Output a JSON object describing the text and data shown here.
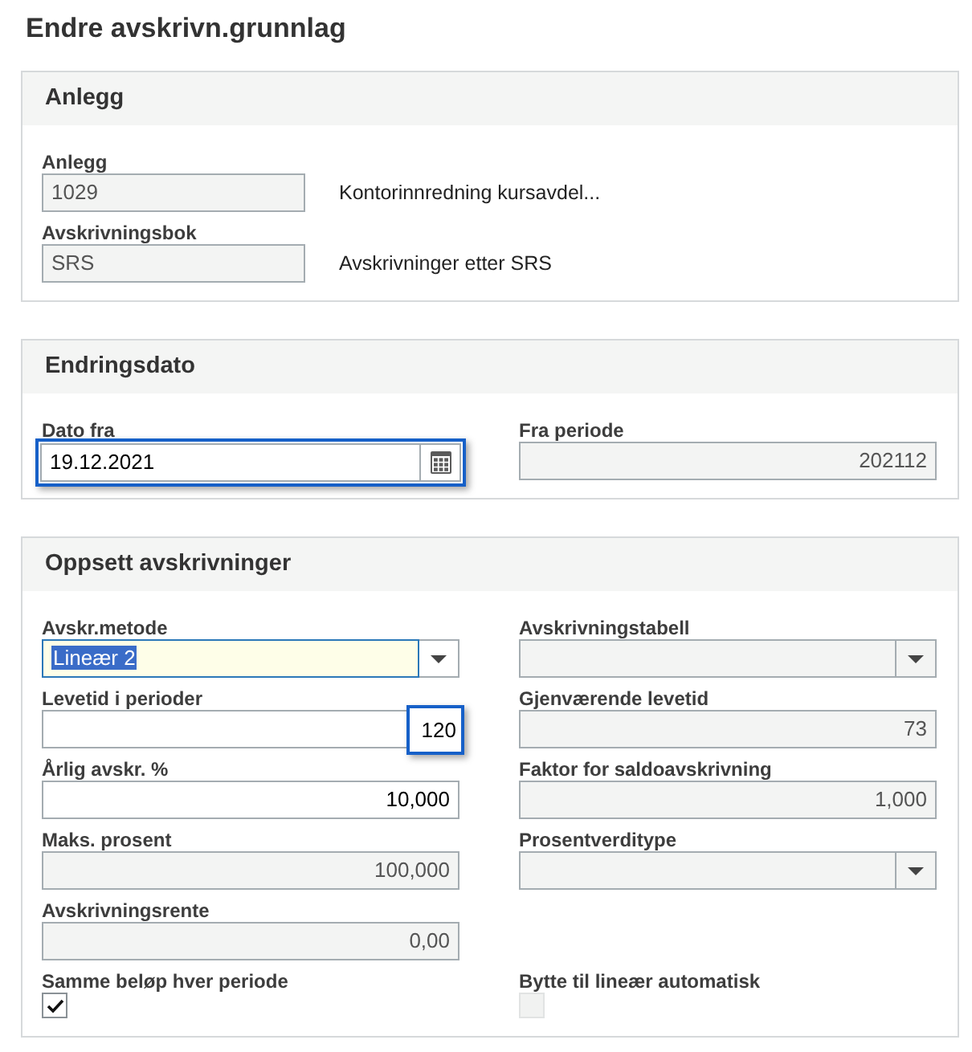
{
  "title": "Endre avskrivn.grunnlag",
  "sections": [
    {
      "heading": "Anlegg",
      "rows": [
        [
          {
            "kind": "text",
            "label": "Anlegg",
            "value": "1029",
            "disabled": true,
            "highlighted": false,
            "description": "Kontorinnredning kursavdel..."
          }
        ],
        [
          {
            "kind": "text",
            "label": "Avskrivningsbok",
            "value": "SRS",
            "disabled": true,
            "highlighted": false,
            "description": "Avskrivninger etter SRS"
          }
        ]
      ]
    },
    {
      "heading": "Endringsdato",
      "rows": [
        [
          {
            "kind": "date",
            "label": "Dato fra",
            "value": "19.12.2021",
            "disabled": false,
            "highlighted": true
          },
          {
            "kind": "number",
            "label": "Fra periode",
            "value": "202112",
            "disabled": true,
            "highlighted": false
          }
        ]
      ]
    },
    {
      "heading": "Oppsett avskrivninger",
      "rows": [
        [
          {
            "kind": "select",
            "label": "Avskr.metode",
            "value": "Lineær 2",
            "disabled": false,
            "highlighted": false,
            "active": true,
            "text_selected": true
          },
          {
            "kind": "select",
            "label": "Avskrivningstabell",
            "disabled": true,
            "highlighted": false,
            "active": false
          }
        ],
        [
          {
            "kind": "number",
            "label": "Levetid i perioder",
            "value": "120",
            "disabled": false,
            "highlighted": true
          },
          {
            "kind": "number",
            "label": "Gjenværende levetid",
            "value": "73",
            "disabled": true,
            "highlighted": false
          }
        ],
        [
          {
            "kind": "number",
            "label": "Årlig avskr. %",
            "value": "10,000",
            "disabled": false,
            "highlighted": false
          },
          {
            "kind": "number",
            "label": "Faktor for saldoavskrivning",
            "value": "1,000",
            "disabled": true,
            "highlighted": false
          }
        ],
        [
          {
            "kind": "number",
            "label": "Maks. prosent",
            "value": "100,000",
            "disabled": true,
            "highlighted": false
          },
          {
            "kind": "select",
            "label": "Prosentverditype",
            "disabled": true,
            "highlighted": false,
            "active": false
          }
        ],
        [
          {
            "kind": "number",
            "label": "Avskrivningsrente",
            "value": "0,00",
            "disabled": true,
            "highlighted": false
          }
        ],
        [
          {
            "kind": "checkbox",
            "label": "Samme beløp hver periode",
            "checked": true,
            "disabled": false
          },
          {
            "kind": "checkbox",
            "label": "Bytte til lineær automatisk",
            "checked": false,
            "disabled": true
          }
        ]
      ]
    }
  ]
}
